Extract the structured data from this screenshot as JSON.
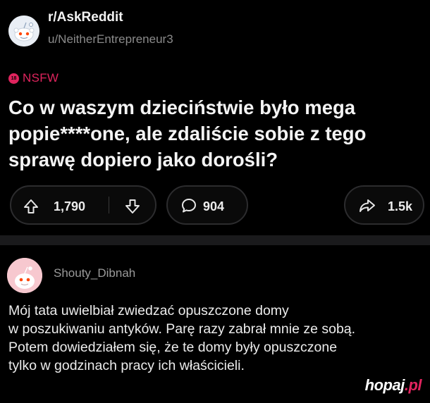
{
  "post": {
    "subreddit": "r/AskReddit",
    "username": "u/NeitherEntrepreneur3",
    "nsfw_label": "NSFW",
    "nsfw_badge": "18",
    "title": "Co w waszym dzieciństwie było mega popie****one, ale zdaliście sobie z tego sprawę dopiero jako dorośli?",
    "upvotes": "1,790",
    "comments": "904",
    "shares": "1.5k"
  },
  "comment": {
    "username": "Shouty_Dibnah",
    "lines": [
      "Mój tata uwielbiał zwiedzać opuszczone domy",
      "w poszukiwaniu antyków. Parę razy zabrał mnie ze sobą.",
      "Potem dowiedziałem się, że te domy były opuszczone",
      "tylko w godzinach pracy ich właścicieli."
    ]
  },
  "watermark": {
    "main": "hopaj",
    "tld": ".pl"
  },
  "colors": {
    "background": "#000000",
    "nsfw": "#e0245e",
    "text": "#f4f4f4",
    "muted": "#8b8b8b"
  }
}
